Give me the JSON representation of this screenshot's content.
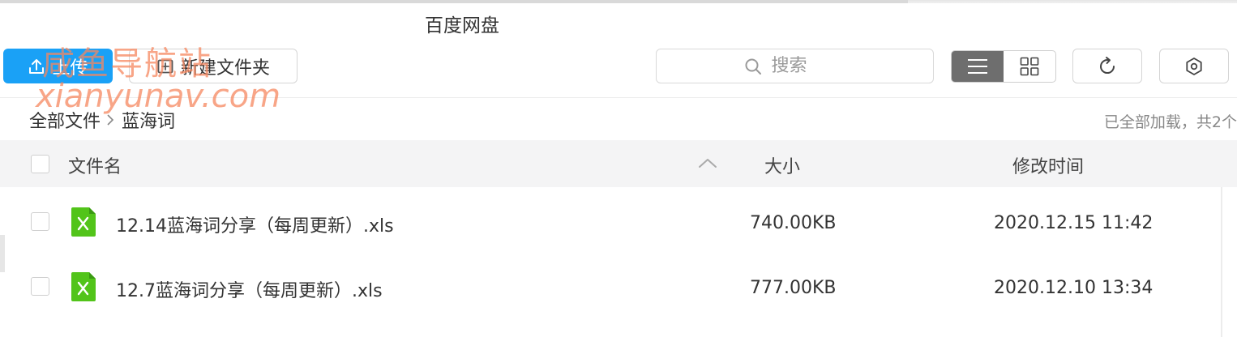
{
  "window": {
    "title": "百度网盘"
  },
  "toolbar": {
    "upload_label": "上传",
    "new_folder_label": "新建文件夹",
    "search_placeholder": "搜索",
    "view_mode": "list"
  },
  "breadcrumb": {
    "root": "全部文件",
    "current": "蓝海词"
  },
  "load_status": "已全部加载，共2个",
  "columns": {
    "name": "文件名",
    "size": "大小",
    "modified": "修改时间"
  },
  "files": [
    {
      "name": "12.14蓝海词分享（每周更新）.xls",
      "size": "740.00KB",
      "modified": "2020.12.15 11:42",
      "icon": "excel-file-icon"
    },
    {
      "name": "12.7蓝海词分享（每周更新）.xls",
      "size": "777.00KB",
      "modified": "2020.12.10 13:34",
      "icon": "excel-file-icon"
    }
  ],
  "watermark": {
    "line1": "咸鱼导航站",
    "line2": "xianyunav.com"
  },
  "colors": {
    "accent": "#1aa1f6",
    "excel_green": "#52c41a",
    "header_bg": "#f4f4f5",
    "watermark": "#f5875f"
  }
}
